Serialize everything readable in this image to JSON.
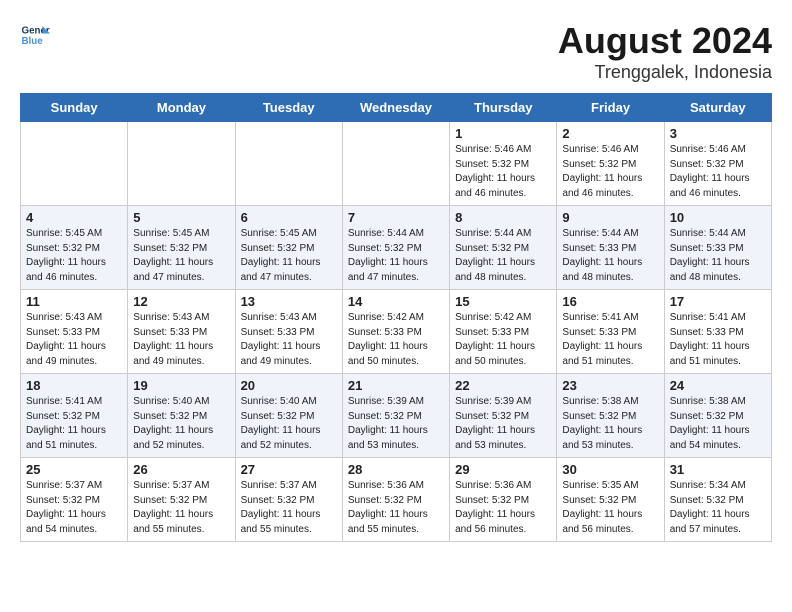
{
  "header": {
    "logo_line1": "General",
    "logo_line2": "Blue",
    "title": "August 2024",
    "subtitle": "Trenggalek, Indonesia"
  },
  "days_of_week": [
    "Sunday",
    "Monday",
    "Tuesday",
    "Wednesday",
    "Thursday",
    "Friday",
    "Saturday"
  ],
  "weeks": [
    [
      {
        "num": "",
        "info": ""
      },
      {
        "num": "",
        "info": ""
      },
      {
        "num": "",
        "info": ""
      },
      {
        "num": "",
        "info": ""
      },
      {
        "num": "1",
        "info": "Sunrise: 5:46 AM\nSunset: 5:32 PM\nDaylight: 11 hours\nand 46 minutes."
      },
      {
        "num": "2",
        "info": "Sunrise: 5:46 AM\nSunset: 5:32 PM\nDaylight: 11 hours\nand 46 minutes."
      },
      {
        "num": "3",
        "info": "Sunrise: 5:46 AM\nSunset: 5:32 PM\nDaylight: 11 hours\nand 46 minutes."
      }
    ],
    [
      {
        "num": "4",
        "info": "Sunrise: 5:45 AM\nSunset: 5:32 PM\nDaylight: 11 hours\nand 46 minutes."
      },
      {
        "num": "5",
        "info": "Sunrise: 5:45 AM\nSunset: 5:32 PM\nDaylight: 11 hours\nand 47 minutes."
      },
      {
        "num": "6",
        "info": "Sunrise: 5:45 AM\nSunset: 5:32 PM\nDaylight: 11 hours\nand 47 minutes."
      },
      {
        "num": "7",
        "info": "Sunrise: 5:44 AM\nSunset: 5:32 PM\nDaylight: 11 hours\nand 47 minutes."
      },
      {
        "num": "8",
        "info": "Sunrise: 5:44 AM\nSunset: 5:32 PM\nDaylight: 11 hours\nand 48 minutes."
      },
      {
        "num": "9",
        "info": "Sunrise: 5:44 AM\nSunset: 5:33 PM\nDaylight: 11 hours\nand 48 minutes."
      },
      {
        "num": "10",
        "info": "Sunrise: 5:44 AM\nSunset: 5:33 PM\nDaylight: 11 hours\nand 48 minutes."
      }
    ],
    [
      {
        "num": "11",
        "info": "Sunrise: 5:43 AM\nSunset: 5:33 PM\nDaylight: 11 hours\nand 49 minutes."
      },
      {
        "num": "12",
        "info": "Sunrise: 5:43 AM\nSunset: 5:33 PM\nDaylight: 11 hours\nand 49 minutes."
      },
      {
        "num": "13",
        "info": "Sunrise: 5:43 AM\nSunset: 5:33 PM\nDaylight: 11 hours\nand 49 minutes."
      },
      {
        "num": "14",
        "info": "Sunrise: 5:42 AM\nSunset: 5:33 PM\nDaylight: 11 hours\nand 50 minutes."
      },
      {
        "num": "15",
        "info": "Sunrise: 5:42 AM\nSunset: 5:33 PM\nDaylight: 11 hours\nand 50 minutes."
      },
      {
        "num": "16",
        "info": "Sunrise: 5:41 AM\nSunset: 5:33 PM\nDaylight: 11 hours\nand 51 minutes."
      },
      {
        "num": "17",
        "info": "Sunrise: 5:41 AM\nSunset: 5:33 PM\nDaylight: 11 hours\nand 51 minutes."
      }
    ],
    [
      {
        "num": "18",
        "info": "Sunrise: 5:41 AM\nSunset: 5:32 PM\nDaylight: 11 hours\nand 51 minutes."
      },
      {
        "num": "19",
        "info": "Sunrise: 5:40 AM\nSunset: 5:32 PM\nDaylight: 11 hours\nand 52 minutes."
      },
      {
        "num": "20",
        "info": "Sunrise: 5:40 AM\nSunset: 5:32 PM\nDaylight: 11 hours\nand 52 minutes."
      },
      {
        "num": "21",
        "info": "Sunrise: 5:39 AM\nSunset: 5:32 PM\nDaylight: 11 hours\nand 53 minutes."
      },
      {
        "num": "22",
        "info": "Sunrise: 5:39 AM\nSunset: 5:32 PM\nDaylight: 11 hours\nand 53 minutes."
      },
      {
        "num": "23",
        "info": "Sunrise: 5:38 AM\nSunset: 5:32 PM\nDaylight: 11 hours\nand 53 minutes."
      },
      {
        "num": "24",
        "info": "Sunrise: 5:38 AM\nSunset: 5:32 PM\nDaylight: 11 hours\nand 54 minutes."
      }
    ],
    [
      {
        "num": "25",
        "info": "Sunrise: 5:37 AM\nSunset: 5:32 PM\nDaylight: 11 hours\nand 54 minutes."
      },
      {
        "num": "26",
        "info": "Sunrise: 5:37 AM\nSunset: 5:32 PM\nDaylight: 11 hours\nand 55 minutes."
      },
      {
        "num": "27",
        "info": "Sunrise: 5:37 AM\nSunset: 5:32 PM\nDaylight: 11 hours\nand 55 minutes."
      },
      {
        "num": "28",
        "info": "Sunrise: 5:36 AM\nSunset: 5:32 PM\nDaylight: 11 hours\nand 55 minutes."
      },
      {
        "num": "29",
        "info": "Sunrise: 5:36 AM\nSunset: 5:32 PM\nDaylight: 11 hours\nand 56 minutes."
      },
      {
        "num": "30",
        "info": "Sunrise: 5:35 AM\nSunset: 5:32 PM\nDaylight: 11 hours\nand 56 minutes."
      },
      {
        "num": "31",
        "info": "Sunrise: 5:34 AM\nSunset: 5:32 PM\nDaylight: 11 hours\nand 57 minutes."
      }
    ]
  ]
}
